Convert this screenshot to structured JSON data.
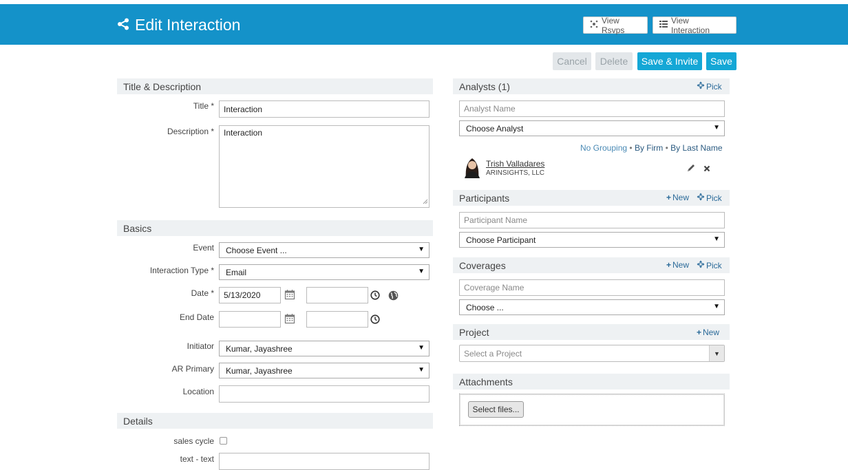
{
  "header": {
    "title": "Edit Interaction",
    "view_rsvps": "View Rsvps",
    "view_interaction": "View Interaction"
  },
  "actions": {
    "cancel": "Cancel",
    "delete": "Delete",
    "save_invite": "Save & Invite",
    "save": "Save"
  },
  "title_desc": {
    "section": "Title & Description",
    "title_label": "Title *",
    "title_value": "Interaction",
    "desc_label": "Description *",
    "desc_value": "Interaction"
  },
  "basics": {
    "section": "Basics",
    "event_label": "Event",
    "event_value": "Choose Event ...",
    "type_label": "Interaction Type *",
    "type_value": "Email",
    "date_label": "Date *",
    "date_value": "5/13/2020",
    "end_date_label": "End Date",
    "initiator_label": "Initiator",
    "initiator_value": "Kumar, Jayashree",
    "ar_primary_label": "AR Primary",
    "ar_primary_value": "Kumar, Jayashree",
    "location_label": "Location"
  },
  "details": {
    "section": "Details",
    "sales_cycle_label": "sales cycle",
    "text_label": "text - text"
  },
  "analysts": {
    "section": "Analysts (1)",
    "pick": "Pick",
    "name_placeholder": "Analyst Name",
    "choose": "Choose Analyst",
    "grouping_no": "No Grouping",
    "grouping_sep": "•",
    "grouping_firm": "By Firm",
    "grouping_last": "By Last Name",
    "analyst_name": "Trish Valladares",
    "analyst_firm": "ARINSIGHTS, LLC"
  },
  "participants": {
    "section": "Participants",
    "new": "New",
    "pick": "Pick",
    "name_placeholder": "Participant Name",
    "choose": "Choose Participant"
  },
  "coverages": {
    "section": "Coverages",
    "new": "New",
    "pick": "Pick",
    "name_placeholder": "Coverage Name",
    "choose": "Choose ..."
  },
  "project": {
    "section": "Project",
    "new": "New",
    "placeholder": "Select a Project"
  },
  "attachments": {
    "section": "Attachments",
    "select_files": "Select files..."
  }
}
